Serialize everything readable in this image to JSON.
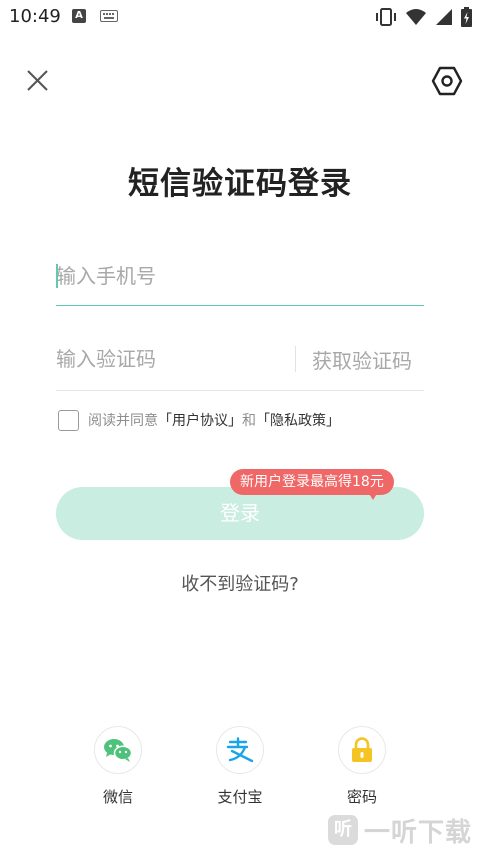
{
  "status_bar": {
    "time": "10:49",
    "a_badge": "A"
  },
  "title": "短信验证码登录",
  "phone": {
    "placeholder": "输入手机号",
    "value": ""
  },
  "code": {
    "placeholder": "输入验证码",
    "value": "",
    "get_code_label": "获取验证码"
  },
  "agreement": {
    "prefix": "阅读并同意",
    "user_agreement": "「用户协议」",
    "and": "和",
    "privacy_policy": "「隐私政策」",
    "checked": false
  },
  "promo": {
    "badge": "新用户登录最高得18元"
  },
  "login_button": "登录",
  "no_code_link": "收不到验证码?",
  "third_party": [
    {
      "label": "微信",
      "icon": "wechat-icon",
      "color": "#4cc27a"
    },
    {
      "label": "支付宝",
      "icon": "alipay-icon",
      "color": "#1aa5e8"
    },
    {
      "label": "密码",
      "icon": "lock-icon",
      "color": "#f5c322"
    }
  ],
  "watermark": {
    "logo": "听",
    "text": "一听下载"
  },
  "colors": {
    "accent": "#5fc9b3",
    "login_disabled": "#c9ede1",
    "promo": "#f06767"
  }
}
